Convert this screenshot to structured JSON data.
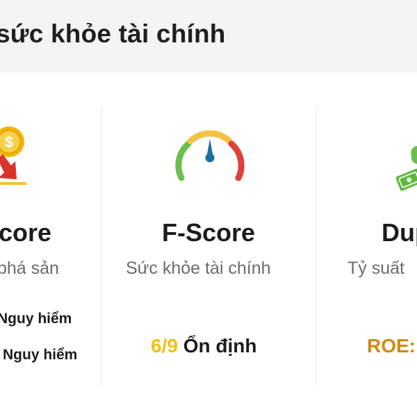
{
  "header": {
    "title": "sức khỏe tài chính"
  },
  "cards": {
    "left": {
      "title": "core",
      "subtitle": "phá sản",
      "risk_lines": [
        "Nguy hiểm",
        "Nguy hiểm"
      ],
      "icon": "dollar-coin-down-arrow-icon"
    },
    "middle": {
      "title": "F-Score",
      "subtitle": "Sức khỏe tài chính",
      "score_value": "6/9",
      "score_status": "Ổn định",
      "icon": "gauge-icon"
    },
    "right": {
      "title": "Dup",
      "subtitle": "Tỷ suất",
      "metric": "ROE:",
      "icon": "money-icon"
    }
  },
  "colors": {
    "header_bg": "#f4f4f4",
    "score_yellow": "#f2c011",
    "roe_orange": "#d08a12",
    "gauge_green": "#6bbf4e",
    "gauge_yellow": "#f3c242",
    "gauge_red": "#e0403a",
    "needle_blue": "#1e6fa6",
    "coin_gold": "#f4b400",
    "arrow_red": "#d9342b"
  }
}
